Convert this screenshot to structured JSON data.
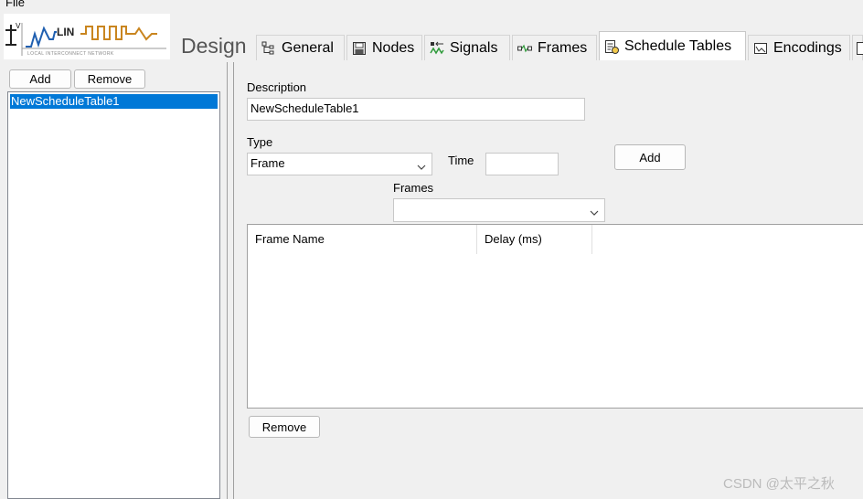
{
  "menubar": {
    "file": "File"
  },
  "header": {
    "logo_text": "LIN",
    "logo_subtext": "LOCAL INTERCONNECT NETWORK",
    "design_label": "Design"
  },
  "tabs": [
    {
      "label": "General",
      "icon": "tree-icon",
      "active": false
    },
    {
      "label": "Nodes",
      "icon": "floppy-icon",
      "active": false
    },
    {
      "label": "Signals",
      "icon": "signals-icon",
      "active": false
    },
    {
      "label": "Frames",
      "icon": "frames-icon",
      "active": false
    },
    {
      "label": "Schedule Tables",
      "icon": "schedule-icon",
      "active": true
    },
    {
      "label": "Encodings",
      "icon": "encodings-icon",
      "active": false
    }
  ],
  "left_pane": {
    "add_label": "Add",
    "remove_label": "Remove",
    "items": [
      {
        "label": "NewScheduleTable1",
        "selected": true
      }
    ]
  },
  "form": {
    "description_label": "Description",
    "description_value": "NewScheduleTable1",
    "type_label": "Type",
    "type_value": "Frame",
    "time_label": "Time",
    "time_value": "",
    "add_label": "Add",
    "frames_label": "Frames",
    "frames_value": "",
    "grid_columns": [
      "Frame Name",
      "Delay (ms)"
    ],
    "remove_label": "Remove"
  },
  "watermark": "CSDN @太平之秋",
  "colors": {
    "selection": "#0078d7",
    "window_bg": "#f0f0f0"
  }
}
